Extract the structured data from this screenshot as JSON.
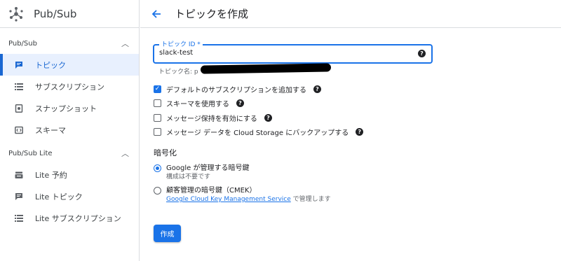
{
  "app": {
    "title": "Pub/Sub"
  },
  "sidebar": {
    "sections": [
      {
        "title": "Pub/Sub",
        "items": [
          {
            "label": "トピック",
            "icon": "topic-icon",
            "active": true
          },
          {
            "label": "サブスクリプション",
            "icon": "list-icon"
          },
          {
            "label": "スナップショット",
            "icon": "snapshot-icon"
          },
          {
            "label": "スキーマ",
            "icon": "schema-icon"
          }
        ]
      },
      {
        "title": "Pub/Sub Lite",
        "items": [
          {
            "label": "Lite 予約",
            "icon": "reservation-icon"
          },
          {
            "label": "Lite トピック",
            "icon": "topic-icon"
          },
          {
            "label": "Lite サブスクリプション",
            "icon": "list-icon"
          }
        ]
      }
    ]
  },
  "header": {
    "title": "トピックを作成"
  },
  "form": {
    "topic_id_label": "トピック ID *",
    "topic_id_value": "slack-test",
    "topic_name_hint": "トピック名: p",
    "checkboxes": [
      {
        "label": "デフォルトのサブスクリプションを追加する",
        "checked": true
      },
      {
        "label": "スキーマを使用する",
        "checked": false
      },
      {
        "label": "メッセージ保持を有効にする",
        "checked": false
      },
      {
        "label": "メッセージ データを Cloud Storage にバックアップする",
        "checked": false
      }
    ],
    "encryption": {
      "title": "暗号化",
      "option1_label": "Google が管理する暗号鍵",
      "option1_sub": "構成は不要です",
      "option2_label": "顧客管理の暗号鍵（CMEK）",
      "option2_link": "Google Cloud Key Management Service",
      "option2_suffix": " で管理します"
    },
    "submit_label": "作成"
  },
  "colors": {
    "accent": "#1a73e8",
    "active_bg": "#e8f0fe"
  }
}
